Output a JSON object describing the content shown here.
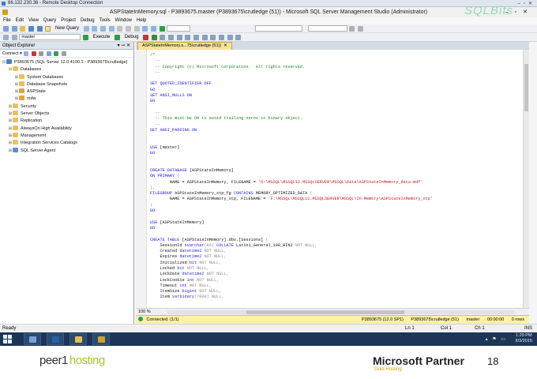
{
  "rdp": {
    "title": "66.132.230.36 - Remote Desktop Connection"
  },
  "window": {
    "title": "ASPStateInMemory.sql - P3893675.master (P3893675\\crutledge (51)) - Microsoft SQL Server Management Studio (Administrator)"
  },
  "menu": [
    "File",
    "Edit",
    "View",
    "Query",
    "Project",
    "Debug",
    "Tools",
    "Window",
    "Help"
  ],
  "toolbar": {
    "new_query": "New Query",
    "database_select": "master",
    "execute": "Execute",
    "debug": "Debug"
  },
  "object_explorer": {
    "title": "Object Explorer",
    "connect": "Connect ▾",
    "nodes": [
      {
        "label": "P3893675 (SQL Server 12.0.4100.1 - P3893675\\crutledge)",
        "exp": "⊟",
        "icon": "server-icon",
        "color": "#4a7fc1"
      },
      {
        "label": "Databases",
        "exp": "⊟",
        "icon": "folder-icon",
        "color": "#e8c15a"
      },
      {
        "label": "System Databases",
        "exp": "⊞",
        "icon": "folder-icon",
        "color": "#e8c15a"
      },
      {
        "label": "Database Snapshots",
        "exp": "⊞",
        "icon": "folder-icon",
        "color": "#e8c15a"
      },
      {
        "label": "ASPState",
        "exp": "⊞",
        "icon": "database-icon",
        "color": "#d9a640"
      },
      {
        "label": "mdw",
        "exp": "⊞",
        "icon": "database-icon",
        "color": "#d9a640"
      },
      {
        "label": "Security",
        "exp": "⊞",
        "icon": "folder-icon",
        "color": "#e8c15a"
      },
      {
        "label": "Server Objects",
        "exp": "⊞",
        "icon": "folder-icon",
        "color": "#e8c15a"
      },
      {
        "label": "Replication",
        "exp": "⊞",
        "icon": "folder-icon",
        "color": "#e8c15a"
      },
      {
        "label": "AlwaysOn High Availability",
        "exp": "⊞",
        "icon": "folder-icon",
        "color": "#e8c15a"
      },
      {
        "label": "Management",
        "exp": "⊞",
        "icon": "folder-icon",
        "color": "#e8c15a"
      },
      {
        "label": "Integration Services Catalogs",
        "exp": "⊞",
        "icon": "folder-icon",
        "color": "#e8c15a"
      },
      {
        "label": "SQL Server Agent",
        "exp": "⊞",
        "icon": "agent-icon",
        "color": "#5b8fd0"
      }
    ]
  },
  "editor": {
    "tab_label": "ASPStateInMemory.s...75\\crutledge (51))",
    "zoom": "100 %",
    "code_lines": [
      [
        {
          "t": "/*",
          "c": "cm"
        }
      ],
      [
        {
          "t": "  --",
          "c": "cm"
        }
      ],
      [
        {
          "t": "  -- Copyright (c) Microsoft Corporation.  All rights reserved.",
          "c": "cm"
        }
      ],
      [
        {
          "t": "  --",
          "c": "cm"
        }
      ],
      [
        {
          "t": "",
          "c": "tx"
        }
      ],
      [
        {
          "t": "SET ",
          "c": "kw"
        },
        {
          "t": "QUOTED_IDENTIFIER ",
          "c": "kw"
        },
        {
          "t": "OFF",
          "c": "kw"
        }
      ],
      [
        {
          "t": "GO",
          "c": "kw"
        }
      ],
      [
        {
          "t": "SET ",
          "c": "kw"
        },
        {
          "t": "ANSI_NULLS ",
          "c": "kw"
        },
        {
          "t": "ON",
          "c": "kw"
        }
      ],
      [
        {
          "t": "GO",
          "c": "kw"
        }
      ],
      [
        {
          "t": "",
          "c": "tx"
        }
      ],
      [
        {
          "t": "  --",
          "c": "cm"
        }
      ],
      [
        {
          "t": "  -- This must be ON to avoid trailing zeros in binary object.",
          "c": "cm"
        }
      ],
      [
        {
          "t": "  --",
          "c": "cm"
        }
      ],
      [
        {
          "t": "SET ",
          "c": "kw"
        },
        {
          "t": "ANSI_PADDING ",
          "c": "kw"
        },
        {
          "t": "ON",
          "c": "kw"
        }
      ],
      [
        {
          "t": "",
          "c": "tx"
        }
      ],
      [
        {
          "t": "",
          "c": "tx"
        }
      ],
      [
        {
          "t": "USE ",
          "c": "kw"
        },
        {
          "t": "[master]",
          "c": "tx"
        }
      ],
      [
        {
          "t": "GO",
          "c": "kw"
        }
      ],
      [
        {
          "t": "",
          "c": "tx"
        }
      ],
      [
        {
          "t": "",
          "c": "tx"
        }
      ],
      [
        {
          "t": "CREATE DATABASE ",
          "c": "kw"
        },
        {
          "t": "[ASPStateInMemory]",
          "c": "tx"
        }
      ],
      [
        {
          "t": "ON PRIMARY ",
          "c": "kw"
        },
        {
          "t": "(",
          "c": "gy"
        }
      ],
      [
        {
          "t": "        NAME = ASPStateInMemory, FILENAME = ",
          "c": "tx"
        },
        {
          "t": "'D:\\MSSQL\\MSSQL12.MSSQLSERVER\\MSSQL\\Data\\ASPStateInMemory_data.mdf'",
          "c": "st"
        }
      ],
      [
        {
          "t": "),",
          "c": "gy"
        }
      ],
      [
        {
          "t": "FILEGROUP ",
          "c": "kw"
        },
        {
          "t": "ASPStateInMemory_xtp_fg ",
          "c": "tx"
        },
        {
          "t": "CONTAINS ",
          "c": "kw"
        },
        {
          "t": "MEMORY_OPTIMIZED_DATA ",
          "c": "tx"
        },
        {
          "t": "(",
          "c": "gy"
        }
      ],
      [
        {
          "t": "        NAME = ASPStateInMemory_xtp, FILENAME = ",
          "c": "tx"
        },
        {
          "t": "'F:\\MSSQL\\MSSQL12.MSSQLSERVER\\MSSQL\\In-Memory\\ASPStateInMemory_xtp'",
          "c": "st"
        }
      ],
      [
        {
          "t": ")",
          "c": "gy"
        }
      ],
      [
        {
          "t": "GO",
          "c": "kw"
        }
      ],
      [
        {
          "t": "",
          "c": "tx"
        }
      ],
      [
        {
          "t": "USE ",
          "c": "kw"
        },
        {
          "t": "[ASPStateInMemory]",
          "c": "tx"
        }
      ],
      [
        {
          "t": "GO",
          "c": "kw"
        }
      ],
      [
        {
          "t": "",
          "c": "tx"
        }
      ],
      [
        {
          "t": "CREATE TABLE ",
          "c": "kw"
        },
        {
          "t": "[ASPStateInMemory]",
          "c": "tx"
        },
        {
          "t": ".dbo.[Sessions]",
          "c": "tx"
        },
        {
          "t": " (",
          "c": "gy"
        }
      ],
      [
        {
          "t": "    SessionId ",
          "c": "tx"
        },
        {
          "t": "nvarchar",
          "c": "kw"
        },
        {
          "t": "(88) ",
          "c": "gy"
        },
        {
          "t": "COLLATE ",
          "c": "kw"
        },
        {
          "t": "Latin1_General_100_BIN2 ",
          "c": "tx"
        },
        {
          "t": "NOT NULL",
          "c": "gy"
        },
        {
          "t": ",",
          "c": "gy"
        }
      ],
      [
        {
          "t": "    Created ",
          "c": "tx"
        },
        {
          "t": "datetime2 ",
          "c": "kw"
        },
        {
          "t": "NOT NULL",
          "c": "gy"
        },
        {
          "t": ",",
          "c": "gy"
        }
      ],
      [
        {
          "t": "    Expires ",
          "c": "tx"
        },
        {
          "t": "datetime2 ",
          "c": "kw"
        },
        {
          "t": "NOT NULL",
          "c": "gy"
        },
        {
          "t": ",",
          "c": "gy"
        }
      ],
      [
        {
          "t": "    Initialized ",
          "c": "tx"
        },
        {
          "t": "bit ",
          "c": "kw"
        },
        {
          "t": "NOT NULL",
          "c": "gy"
        },
        {
          "t": ",",
          "c": "gy"
        }
      ],
      [
        {
          "t": "    Locked ",
          "c": "tx"
        },
        {
          "t": "bit ",
          "c": "kw"
        },
        {
          "t": "NOT NULL",
          "c": "gy"
        },
        {
          "t": ",",
          "c": "gy"
        }
      ],
      [
        {
          "t": "    LockDate ",
          "c": "tx"
        },
        {
          "t": "datetime2 ",
          "c": "kw"
        },
        {
          "t": "NOT NULL",
          "c": "gy"
        },
        {
          "t": ",",
          "c": "gy"
        }
      ],
      [
        {
          "t": "    LockCookie ",
          "c": "tx"
        },
        {
          "t": "int ",
          "c": "kw"
        },
        {
          "t": "NOT NULL",
          "c": "gy"
        },
        {
          "t": ",",
          "c": "gy"
        }
      ],
      [
        {
          "t": "    Timeout ",
          "c": "tx"
        },
        {
          "t": "int ",
          "c": "kw"
        },
        {
          "t": "NOT NULL",
          "c": "gy"
        },
        {
          "t": ",",
          "c": "gy"
        }
      ],
      [
        {
          "t": "    ItemSize ",
          "c": "tx"
        },
        {
          "t": "bigint ",
          "c": "kw"
        },
        {
          "t": "NOT NULL",
          "c": "gy"
        },
        {
          "t": ",",
          "c": "gy"
        }
      ],
      [
        {
          "t": "    Item ",
          "c": "tx"
        },
        {
          "t": "varbinary",
          "c": "kw"
        },
        {
          "t": "(7000) ",
          "c": "gy"
        },
        {
          "t": "NULL",
          "c": "gy"
        },
        {
          "t": ",",
          "c": "gy"
        }
      ]
    ]
  },
  "query_status": {
    "message": "Connected. (1/1)",
    "server": "P3893675 (12.0 SP1)",
    "login": "P3893675\\crutledge (51)",
    "database": "master",
    "time": "00:00:00",
    "rows": "0 rows"
  },
  "status_bar": {
    "state": "Ready",
    "ln": "Ln 1",
    "col": "Col 1",
    "ch": "Ch 1",
    "ins": "INS"
  },
  "taskbar": {
    "time": "1:29 PM",
    "date": "6/3/2015"
  },
  "footer": {
    "logo_a": "peer1",
    "logo_b": "hosting",
    "partner": "Microsoft Partner",
    "partner_sub": "Gold Hosting",
    "page": "18"
  }
}
